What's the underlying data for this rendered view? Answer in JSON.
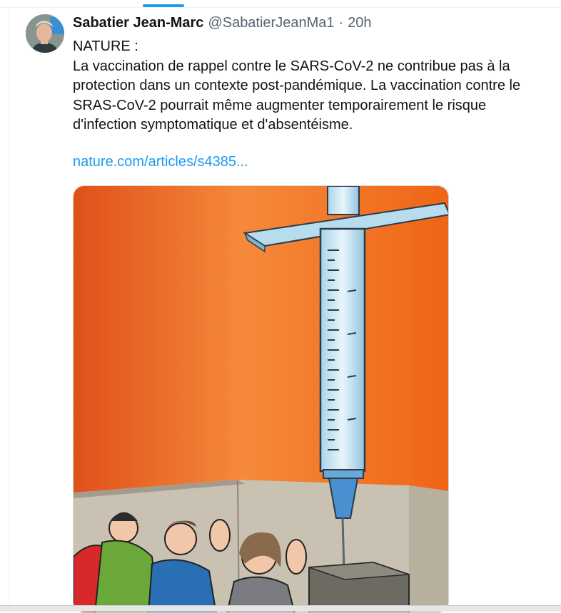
{
  "tweet": {
    "author_name": "Sabatier Jean-Marc",
    "author_handle": "@SabatierJeanMa1",
    "separator": "·",
    "time": "20h",
    "text_lines": [
      "NATURE :",
      "La vaccination de rappel contre le SARS-CoV-2 ne contribue pas à la",
      "protection dans un contexte post-pandémique. La vaccination contre le",
      "SRAS-CoV-2 pourrait même augmenter temporairement le risque",
      "d'infection symptomatique et d'absentéisme."
    ],
    "link": "nature.com/articles/s4385..."
  },
  "icons": {
    "avatar": "avatar-photo",
    "media": "cartoon-syringe-image"
  },
  "colors": {
    "accent": "#1d9bf0",
    "text": "#0f1419",
    "secondary": "#536471",
    "cartoon_background": "#f26a1a"
  }
}
